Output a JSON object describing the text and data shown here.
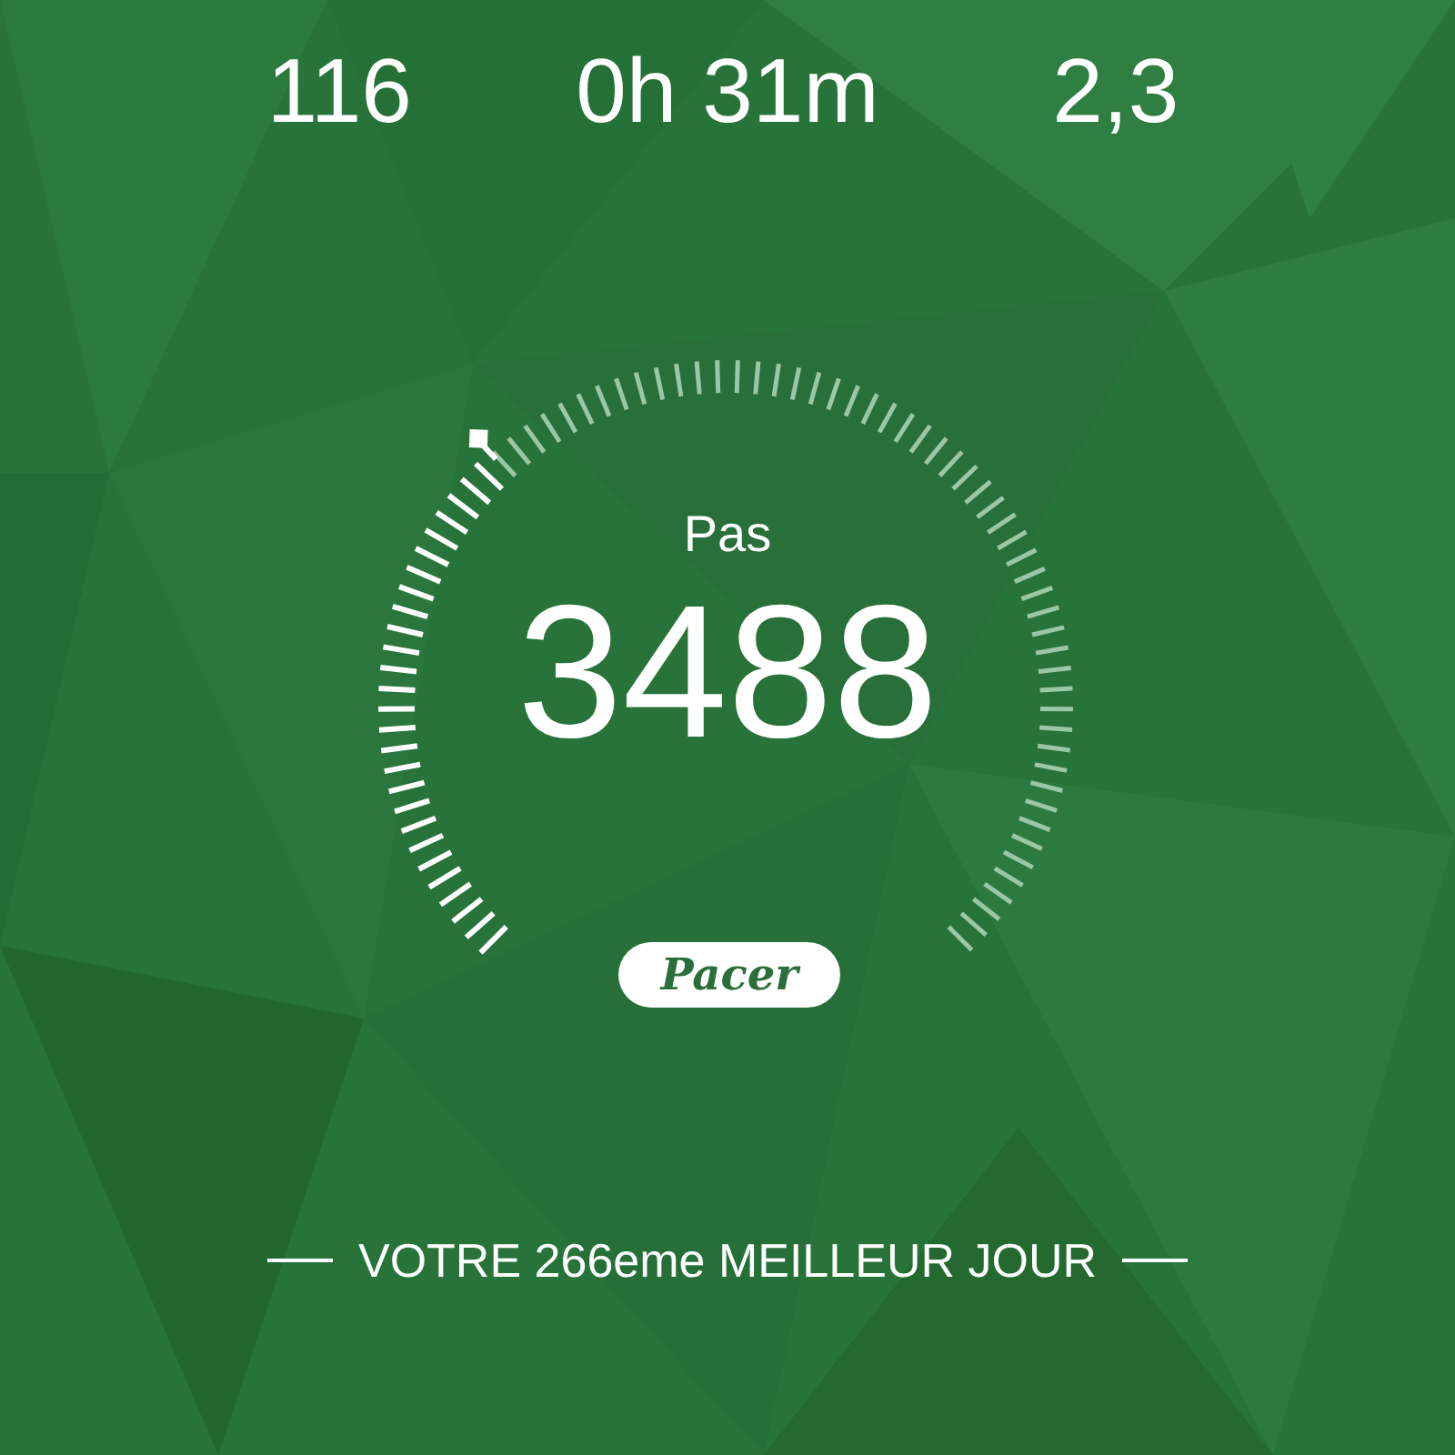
{
  "stats": [
    {
      "value": "116"
    },
    {
      "value": "0h 31m"
    },
    {
      "value": "2,3"
    }
  ],
  "gauge": {
    "label": "Pas",
    "value": "3488"
  },
  "logo": {
    "text": "Pacer"
  },
  "footer": {
    "text": "VOTRE 266eme MEILLEUR JOUR"
  }
}
